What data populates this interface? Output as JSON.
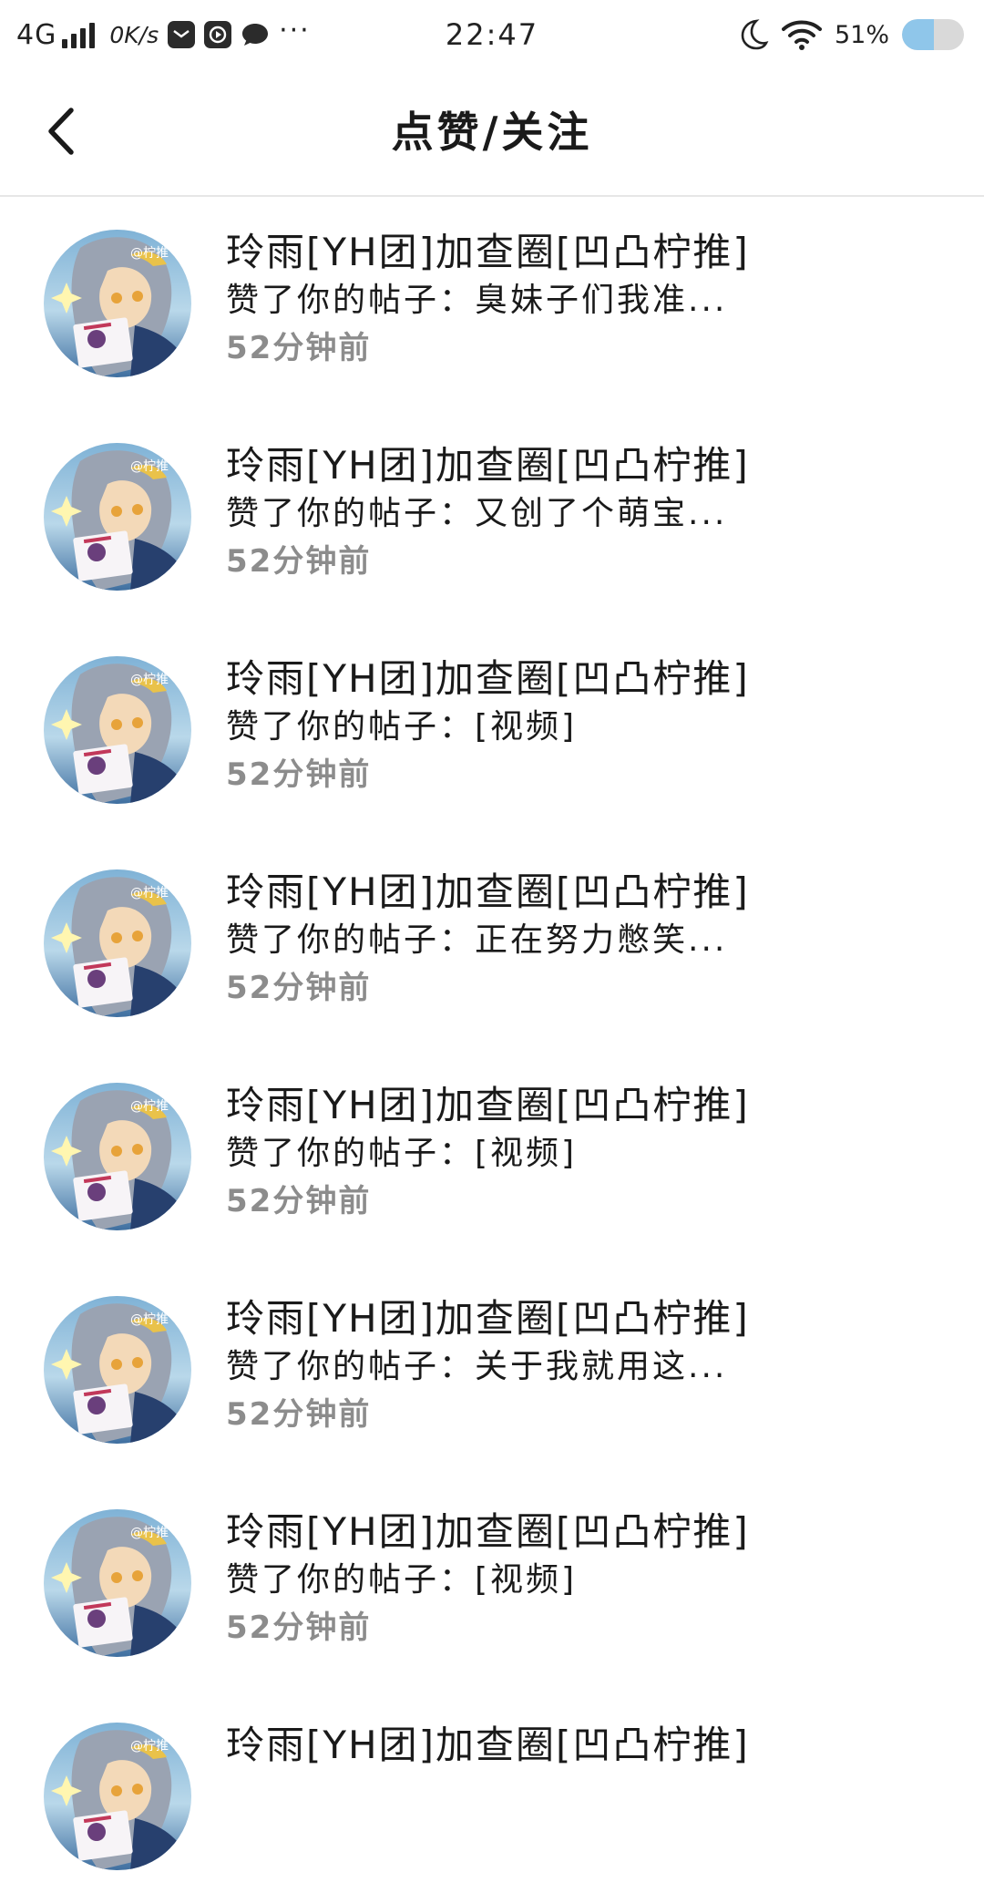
{
  "status_bar": {
    "network": "4G",
    "speed": "0K/s",
    "more": "···",
    "time": "22:47",
    "battery": "51%",
    "battery_level": 0.51,
    "icons": [
      "signal-icon",
      "mail-app-icon",
      "play-app-icon",
      "chat-app-icon",
      "moon-icon",
      "wifi-icon",
      "battery-icon"
    ]
  },
  "header": {
    "back_icon": "chevron-left-icon",
    "title": "点赞/关注"
  },
  "notifications": [
    {
      "name": "玲雨[YH团]加查圈[凹凸柠推]",
      "action": "赞了你的帖子：臭妹子们我准...",
      "time": "52分钟前"
    },
    {
      "name": "玲雨[YH团]加查圈[凹凸柠推]",
      "action": "赞了你的帖子：又创了个萌宝...",
      "time": "52分钟前"
    },
    {
      "name": "玲雨[YH团]加查圈[凹凸柠推]",
      "action": "赞了你的帖子：[视频]",
      "time": "52分钟前"
    },
    {
      "name": "玲雨[YH团]加查圈[凹凸柠推]",
      "action": "赞了你的帖子：正在努力憋笑...",
      "time": "52分钟前"
    },
    {
      "name": "玲雨[YH团]加查圈[凹凸柠推]",
      "action": "赞了你的帖子：[视频]",
      "time": "52分钟前"
    },
    {
      "name": "玲雨[YH团]加查圈[凹凸柠推]",
      "action": "赞了你的帖子：关于我就用这...",
      "time": "52分钟前"
    },
    {
      "name": "玲雨[YH团]加查圈[凹凸柠推]",
      "action": "赞了你的帖子：[视频]",
      "time": "52分钟前"
    },
    {
      "name": "玲雨[YH团]加查圈[凹凸柠推]",
      "action": "",
      "time": ""
    }
  ],
  "colors": {
    "text_primary": "#1a1a1a",
    "text_secondary": "#8c8c8c",
    "divider": "#e6e6e6",
    "battery_fill": "#8fc6ea"
  }
}
